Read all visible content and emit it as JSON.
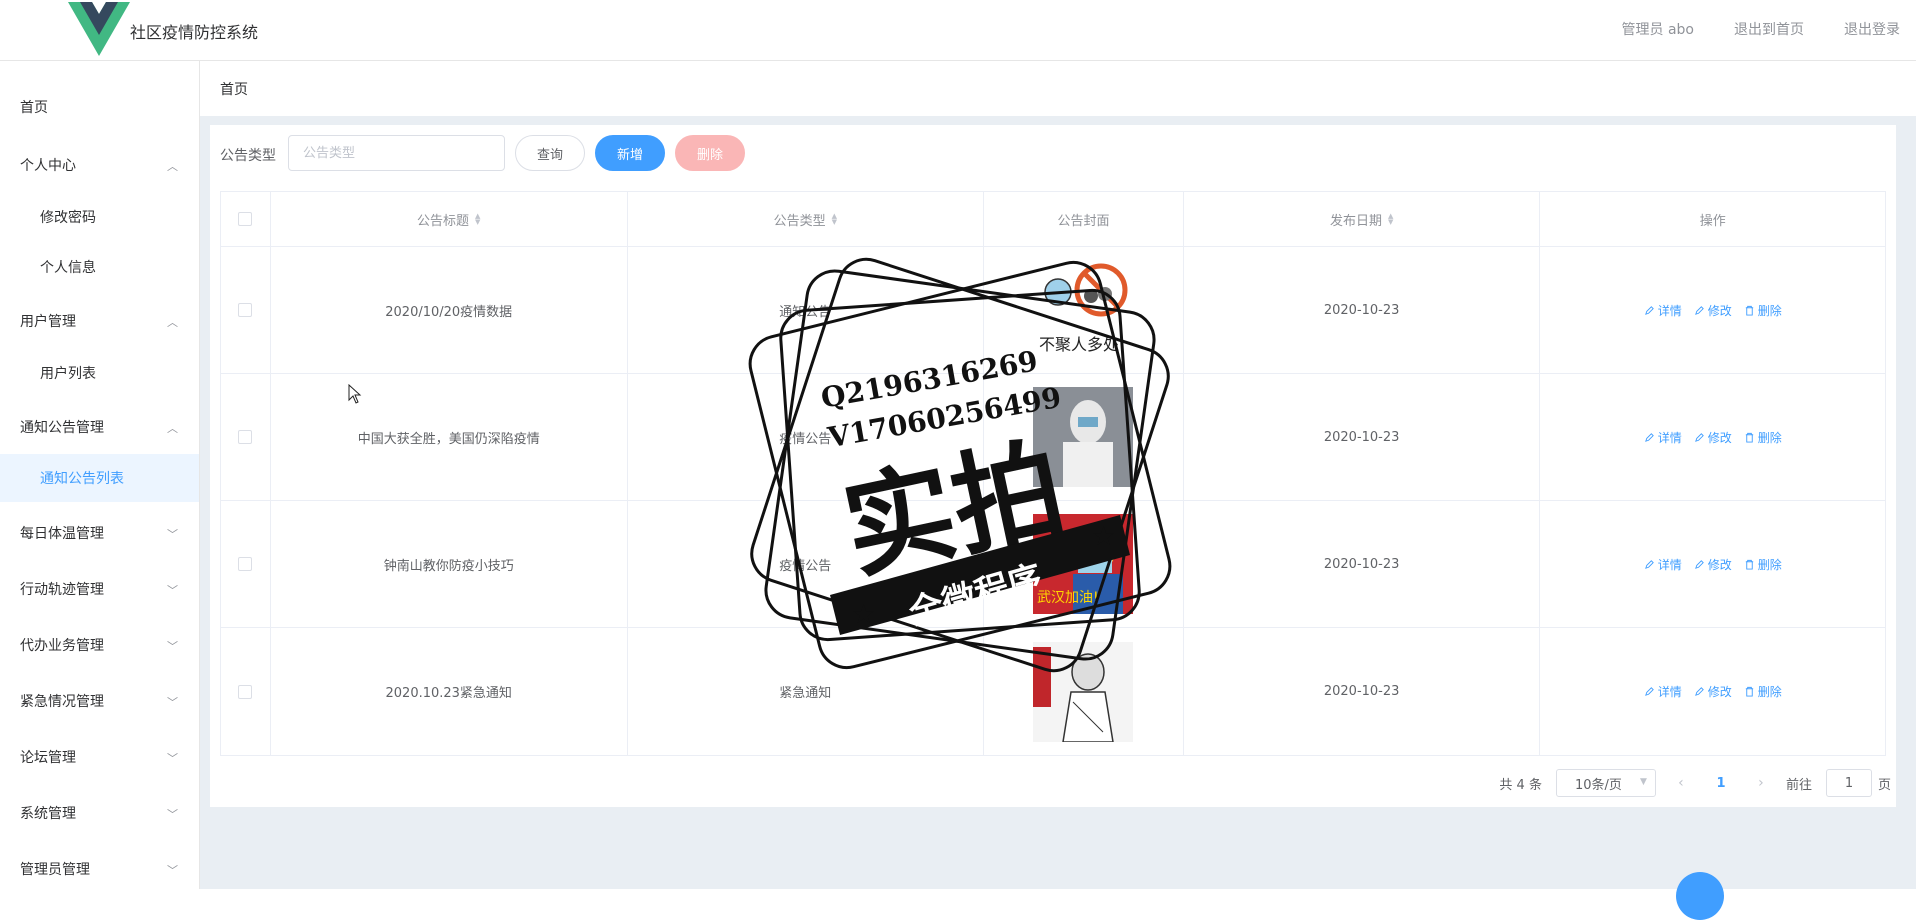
{
  "app": {
    "title": "社区疫情防控系统"
  },
  "header": {
    "user_label": "管理员 abo",
    "back_home": "退出到首页",
    "logout": "退出登录"
  },
  "sidebar": {
    "items": [
      {
        "label": "首页"
      },
      {
        "label": "个人中心"
      },
      {
        "label": "修改密码"
      },
      {
        "label": "个人信息"
      },
      {
        "label": "用户管理"
      },
      {
        "label": "用户列表"
      },
      {
        "label": "通知公告管理"
      },
      {
        "label": "通知公告列表"
      },
      {
        "label": "每日体温管理"
      },
      {
        "label": "行动轨迹管理"
      },
      {
        "label": "代办业务管理"
      },
      {
        "label": "紧急情况管理"
      },
      {
        "label": "论坛管理"
      },
      {
        "label": "系统管理"
      },
      {
        "label": "管理员管理"
      }
    ]
  },
  "breadcrumb": "首页",
  "search": {
    "label": "公告类型",
    "placeholder": "公告类型",
    "query_label": "查询",
    "add_label": "新增",
    "delete_label": "删除"
  },
  "table": {
    "headers": [
      "公告标题",
      "公告类型",
      "公告封面",
      "发布日期",
      "操作"
    ],
    "rows": [
      {
        "title": "2020/10/20疫情数据",
        "type": "通知公告",
        "date": "2020-10-23"
      },
      {
        "title": "中国大获全胜，美国仍深陷疫情",
        "type": "疫情公告",
        "date": "2020-10-23"
      },
      {
        "title": "钟南山教你防疫小技巧",
        "type": "疫情公告",
        "date": "2020-10-23"
      },
      {
        "title": "2020.10.23紧急通知",
        "type": "紧急通知",
        "date": "2020-10-23"
      }
    ],
    "ops": {
      "detail": "详情",
      "edit": "修改",
      "delete": "删除"
    }
  },
  "pagination": {
    "total": "共 4 条",
    "page_size": "10条/页",
    "current": "1",
    "goto_prefix": "前往",
    "goto_value": "1",
    "goto_suffix": "页"
  },
  "watermark": {
    "line1": "Q2196316269",
    "line2": "V17060256499",
    "main": "实拍",
    "banner": "全微程序"
  },
  "thumb_captions": [
    "不聚人多处",
    "武汉加油!"
  ],
  "colors": {
    "primary": "#409eff",
    "danger_light": "#fab6b6",
    "bg": "#e9eef3"
  }
}
